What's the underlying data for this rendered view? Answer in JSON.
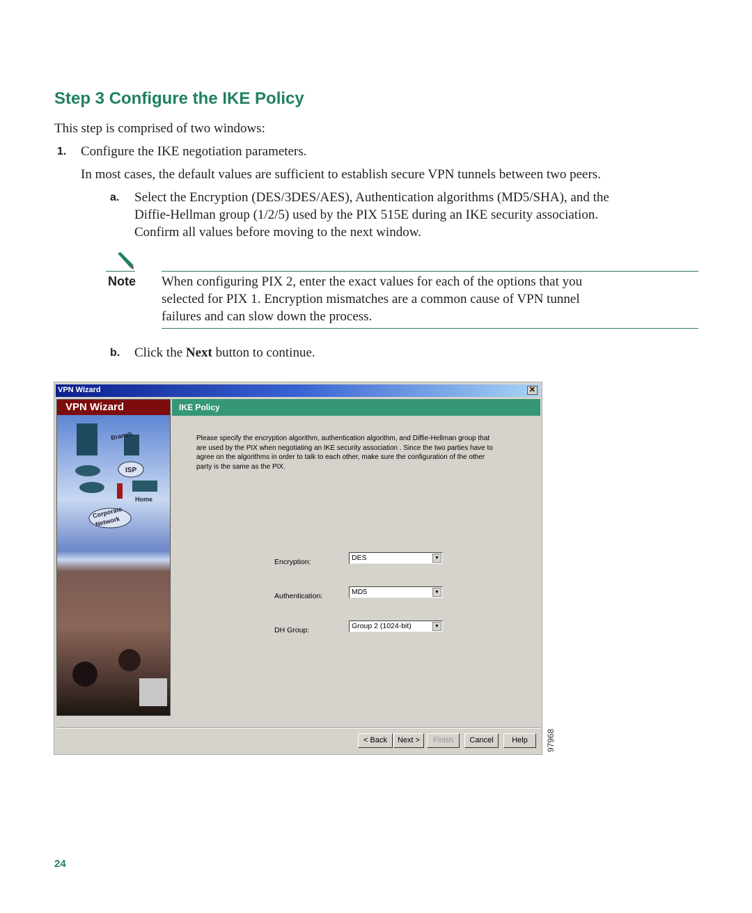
{
  "heading": "Step 3 Configure the IKE Policy",
  "intro": "This step is comprised of two windows:",
  "step1": {
    "number": "1.",
    "text": "Configure the IKE negotiation parameters.",
    "detail": "In most cases, the default values are sufficient to establish secure VPN tunnels between two peers.",
    "sub_a": {
      "label": "a.",
      "lines": [
        "Select the Encryption (DES/3DES/AES), Authentication algorithms (MD5/SHA), and the",
        "Diffie-Hellman group (1/2/5) used by the PIX 515E during an IKE security association.",
        "Confirm all values before moving to the next window."
      ]
    },
    "note": {
      "label": "Note",
      "lines": [
        "When configuring PIX 2, enter the exact values for each of the options that you",
        "selected for PIX 1. Encryption mismatches are a common cause of VPN tunnel",
        "failures and can slow down the process."
      ]
    },
    "sub_b": {
      "label": "b.",
      "pre": "Click the ",
      "bold": "Next",
      "post": " button to continue."
    }
  },
  "window": {
    "title": "VPN Wizard",
    "close": "✕",
    "left_panel_title": "VPN Wizard",
    "image_labels": [
      "Branch",
      "ISP",
      "Home",
      "Corporate Network"
    ],
    "section_title": "IKE Policy",
    "description": [
      "Please specify the encryption algorithm, authentication algorithm, and Diffie-Hellman group that",
      "are used by the PIX when negotiating an IKE security association . Since the two parties have to",
      "agree on the algorithms in order to talk to each other, make sure the configuration of the other",
      "party is the same as the PIX."
    ],
    "fields": [
      {
        "label": "Encryption:",
        "value": "DES"
      },
      {
        "label": "Authentication:",
        "value": "MD5"
      },
      {
        "label": "DH Group:",
        "value": "Group 2 (1024-bit)"
      }
    ],
    "buttons": {
      "back": "< Back",
      "next": "Next >",
      "finish": "Finish",
      "cancel": "Cancel",
      "help": "Help"
    }
  },
  "figure_number": "97968",
  "page_number": "24"
}
